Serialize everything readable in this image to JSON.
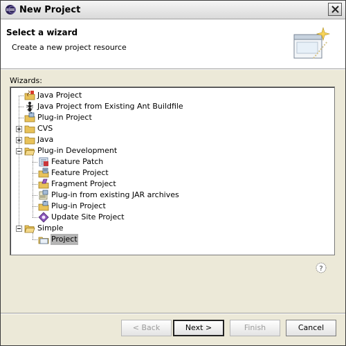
{
  "window": {
    "title": "New Project"
  },
  "banner": {
    "title": "Select a wizard",
    "description": "Create a new project resource"
  },
  "wizards_label": "Wizards:",
  "tree": [
    {
      "label": "Java Project",
      "level": 1,
      "icon": "java-project-icon",
      "expander": null,
      "selected": false
    },
    {
      "label": "Java Project from Existing Ant Buildfile",
      "level": 1,
      "icon": "ant-icon",
      "expander": null,
      "selected": false
    },
    {
      "label": "Plug-in Project",
      "level": 1,
      "icon": "plugin-project-icon",
      "expander": null,
      "selected": false
    },
    {
      "label": "CVS",
      "level": 0,
      "icon": "folder-icon",
      "expander": "plus",
      "selected": false
    },
    {
      "label": "Java",
      "level": 0,
      "icon": "folder-icon",
      "expander": "plus",
      "selected": false
    },
    {
      "label": "Plug-in Development",
      "level": 0,
      "icon": "folder-open-icon",
      "expander": "minus",
      "selected": false
    },
    {
      "label": "Feature Patch",
      "level": 2,
      "icon": "feature-patch-icon",
      "expander": null,
      "selected": false
    },
    {
      "label": "Feature Project",
      "level": 2,
      "icon": "feature-project-icon",
      "expander": null,
      "selected": false
    },
    {
      "label": "Fragment Project",
      "level": 2,
      "icon": "fragment-project-icon",
      "expander": null,
      "selected": false
    },
    {
      "label": "Plug-in from existing JAR archives",
      "level": 2,
      "icon": "plugin-jar-icon",
      "expander": null,
      "selected": false
    },
    {
      "label": "Plug-in Project",
      "level": 2,
      "icon": "plugin-project-icon",
      "expander": null,
      "selected": false
    },
    {
      "label": "Update Site Project",
      "level": 2,
      "icon": "update-site-icon",
      "expander": null,
      "selected": false
    },
    {
      "label": "Simple",
      "level": 0,
      "icon": "folder-open-icon",
      "expander": "minus",
      "selected": false
    },
    {
      "label": "Project",
      "level": 2,
      "icon": "project-icon",
      "expander": null,
      "selected": true
    }
  ],
  "buttons": {
    "back": "< Back",
    "next": "Next >",
    "finish": "Finish",
    "cancel": "Cancel"
  },
  "colors": {
    "selection": "#b4b4b4",
    "folder": "#e8c25a",
    "banner_bg": "#ffffff",
    "dialog_bg": "#ece9d8"
  }
}
